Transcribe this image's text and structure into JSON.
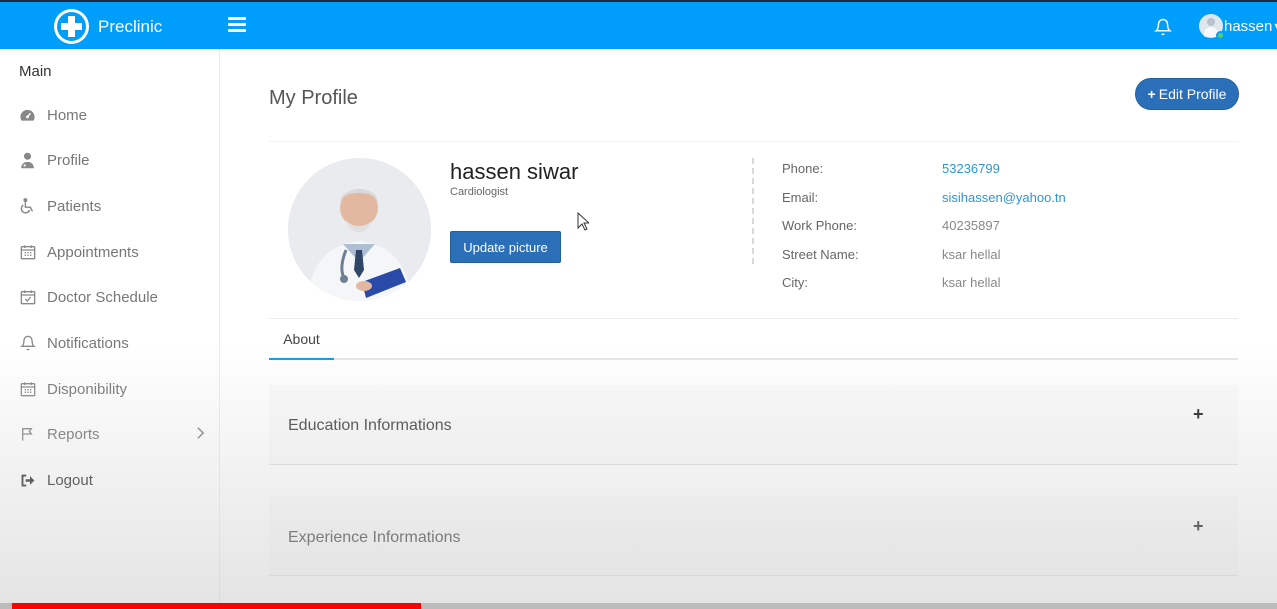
{
  "app": {
    "brand": "Preclinic",
    "user_name": "hassen"
  },
  "sidebar": {
    "title": "Main",
    "items": [
      {
        "label": "Home",
        "icon": "dashboard-icon"
      },
      {
        "label": "Profile",
        "icon": "user-md-icon"
      },
      {
        "label": "Patients",
        "icon": "wheelchair-icon"
      },
      {
        "label": "Appointments",
        "icon": "calendar-icon"
      },
      {
        "label": "Doctor Schedule",
        "icon": "calendar-check-icon"
      },
      {
        "label": "Notifications",
        "icon": "bell-icon"
      },
      {
        "label": "Disponibility",
        "icon": "calendar-icon"
      },
      {
        "label": "Reports",
        "icon": "flag-icon",
        "has_submenu": true
      },
      {
        "label": "Logout",
        "icon": "sign-out-icon"
      }
    ]
  },
  "page": {
    "title": "My Profile",
    "edit_button": "Edit Profile"
  },
  "profile": {
    "name": "hassen siwar",
    "specialty": "Cardiologist",
    "update_button": "Update picture",
    "info": [
      {
        "key": "Phone:",
        "value": "53236799",
        "link": true
      },
      {
        "key": "Email:",
        "value": "sisihassen@yahoo.tn",
        "link": true
      },
      {
        "key": "Work Phone:",
        "value": "40235897",
        "link": false
      },
      {
        "key": "Street Name:",
        "value": "ksar hellal",
        "link": false
      },
      {
        "key": "City:",
        "value": "ksar hellal",
        "link": false
      }
    ]
  },
  "tabs": [
    {
      "label": "About"
    }
  ],
  "sections": [
    {
      "title": "Education Informations",
      "toggle": "+"
    },
    {
      "title": "Experience Informations",
      "toggle": "+"
    }
  ],
  "video_progress": 0.33,
  "colors": {
    "topbar": "#009efb",
    "primary_button": "#2a6fb8",
    "link": "#2e95d8",
    "progress": "#ff0000"
  }
}
